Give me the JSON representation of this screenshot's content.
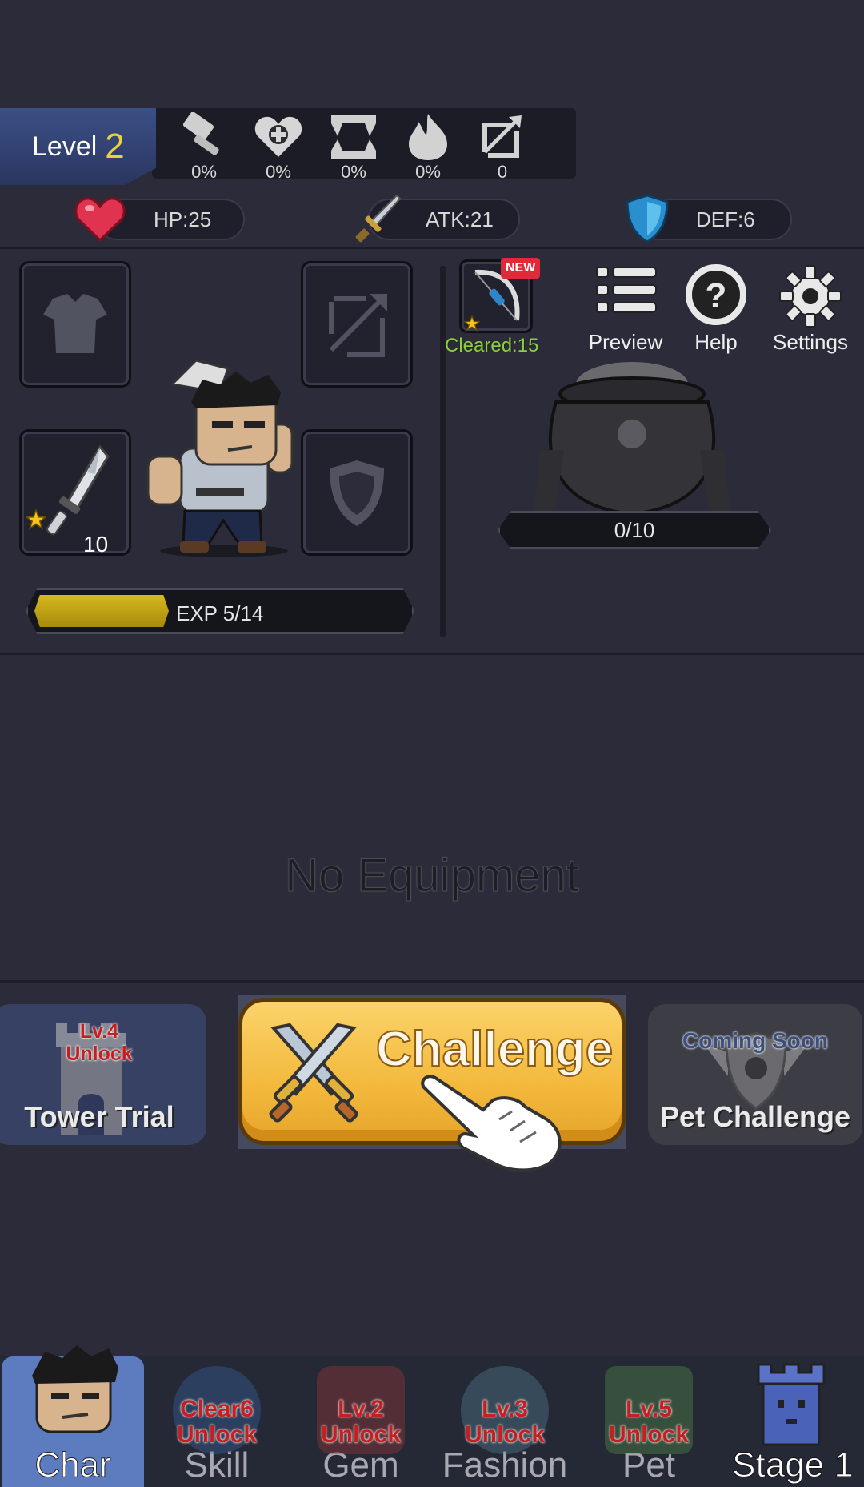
{
  "header": {
    "level_label": "Level",
    "level_value": "2",
    "bonuses": [
      {
        "icon": "hammer-icon",
        "value": "0%"
      },
      {
        "icon": "heart-plus-icon",
        "value": "0%"
      },
      {
        "icon": "fangs-icon",
        "value": "0%"
      },
      {
        "icon": "flame-icon",
        "value": "0%"
      },
      {
        "icon": "broken-bow-icon",
        "value": "0"
      }
    ]
  },
  "stats": {
    "hp": "HP:25",
    "atk": "ATK:21",
    "def": "DEF:6"
  },
  "character": {
    "weapon_level": "10",
    "exp_label": "EXP 5/14",
    "exp_fraction": 0.357
  },
  "right_panel": {
    "new_badge": "NEW",
    "cleared_label": "Cleared:15",
    "preview_label": "Preview",
    "help_label": "Help",
    "settings_label": "Settings",
    "cauldron_progress": "0/10"
  },
  "inventory": {
    "empty_message": "No Equipment"
  },
  "challenge_row": {
    "tower_lock_line1": "Lv.4",
    "tower_lock_line2": "Unlock",
    "tower_title": "Tower Trial",
    "challenge_label": "Challenge",
    "pet_soon": "Coming Soon",
    "pet_title": "Pet Challenge"
  },
  "bottom_nav": {
    "items": [
      {
        "label": "Char",
        "lock1": "",
        "lock2": ""
      },
      {
        "label": "Skill",
        "lock1": "Clear6",
        "lock2": "Unlock"
      },
      {
        "label": "Gem",
        "lock1": "Lv.2",
        "lock2": "Unlock"
      },
      {
        "label": "Fashion",
        "lock1": "Lv.3",
        "lock2": "Unlock"
      },
      {
        "label": "Pet",
        "lock1": "Lv.5",
        "lock2": "Unlock"
      },
      {
        "label": "Stage 1",
        "lock1": "",
        "lock2": ""
      }
    ]
  },
  "colors": {
    "background": "#2b2b3a",
    "level_gold": "#e9d23a",
    "cleared_green": "#8bd23a",
    "lock_red": "#c51f1f",
    "challenge_gold": "#f3b93c",
    "active_tab": "#5d7bbf"
  }
}
